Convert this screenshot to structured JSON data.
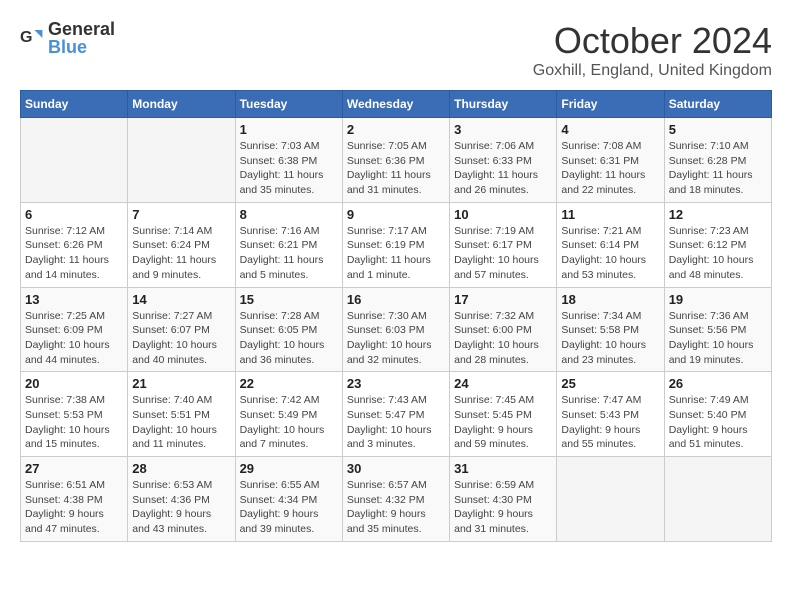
{
  "logo": {
    "general": "General",
    "blue": "Blue"
  },
  "title": "October 2024",
  "location": "Goxhill, England, United Kingdom",
  "days_of_week": [
    "Sunday",
    "Monday",
    "Tuesday",
    "Wednesday",
    "Thursday",
    "Friday",
    "Saturday"
  ],
  "weeks": [
    [
      {
        "day": "",
        "info": ""
      },
      {
        "day": "",
        "info": ""
      },
      {
        "day": "1",
        "info": "Sunrise: 7:03 AM\nSunset: 6:38 PM\nDaylight: 11 hours and 35 minutes."
      },
      {
        "day": "2",
        "info": "Sunrise: 7:05 AM\nSunset: 6:36 PM\nDaylight: 11 hours and 31 minutes."
      },
      {
        "day": "3",
        "info": "Sunrise: 7:06 AM\nSunset: 6:33 PM\nDaylight: 11 hours and 26 minutes."
      },
      {
        "day": "4",
        "info": "Sunrise: 7:08 AM\nSunset: 6:31 PM\nDaylight: 11 hours and 22 minutes."
      },
      {
        "day": "5",
        "info": "Sunrise: 7:10 AM\nSunset: 6:28 PM\nDaylight: 11 hours and 18 minutes."
      }
    ],
    [
      {
        "day": "6",
        "info": "Sunrise: 7:12 AM\nSunset: 6:26 PM\nDaylight: 11 hours and 14 minutes."
      },
      {
        "day": "7",
        "info": "Sunrise: 7:14 AM\nSunset: 6:24 PM\nDaylight: 11 hours and 9 minutes."
      },
      {
        "day": "8",
        "info": "Sunrise: 7:16 AM\nSunset: 6:21 PM\nDaylight: 11 hours and 5 minutes."
      },
      {
        "day": "9",
        "info": "Sunrise: 7:17 AM\nSunset: 6:19 PM\nDaylight: 11 hours and 1 minute."
      },
      {
        "day": "10",
        "info": "Sunrise: 7:19 AM\nSunset: 6:17 PM\nDaylight: 10 hours and 57 minutes."
      },
      {
        "day": "11",
        "info": "Sunrise: 7:21 AM\nSunset: 6:14 PM\nDaylight: 10 hours and 53 minutes."
      },
      {
        "day": "12",
        "info": "Sunrise: 7:23 AM\nSunset: 6:12 PM\nDaylight: 10 hours and 48 minutes."
      }
    ],
    [
      {
        "day": "13",
        "info": "Sunrise: 7:25 AM\nSunset: 6:09 PM\nDaylight: 10 hours and 44 minutes."
      },
      {
        "day": "14",
        "info": "Sunrise: 7:27 AM\nSunset: 6:07 PM\nDaylight: 10 hours and 40 minutes."
      },
      {
        "day": "15",
        "info": "Sunrise: 7:28 AM\nSunset: 6:05 PM\nDaylight: 10 hours and 36 minutes."
      },
      {
        "day": "16",
        "info": "Sunrise: 7:30 AM\nSunset: 6:03 PM\nDaylight: 10 hours and 32 minutes."
      },
      {
        "day": "17",
        "info": "Sunrise: 7:32 AM\nSunset: 6:00 PM\nDaylight: 10 hours and 28 minutes."
      },
      {
        "day": "18",
        "info": "Sunrise: 7:34 AM\nSunset: 5:58 PM\nDaylight: 10 hours and 23 minutes."
      },
      {
        "day": "19",
        "info": "Sunrise: 7:36 AM\nSunset: 5:56 PM\nDaylight: 10 hours and 19 minutes."
      }
    ],
    [
      {
        "day": "20",
        "info": "Sunrise: 7:38 AM\nSunset: 5:53 PM\nDaylight: 10 hours and 15 minutes."
      },
      {
        "day": "21",
        "info": "Sunrise: 7:40 AM\nSunset: 5:51 PM\nDaylight: 10 hours and 11 minutes."
      },
      {
        "day": "22",
        "info": "Sunrise: 7:42 AM\nSunset: 5:49 PM\nDaylight: 10 hours and 7 minutes."
      },
      {
        "day": "23",
        "info": "Sunrise: 7:43 AM\nSunset: 5:47 PM\nDaylight: 10 hours and 3 minutes."
      },
      {
        "day": "24",
        "info": "Sunrise: 7:45 AM\nSunset: 5:45 PM\nDaylight: 9 hours and 59 minutes."
      },
      {
        "day": "25",
        "info": "Sunrise: 7:47 AM\nSunset: 5:43 PM\nDaylight: 9 hours and 55 minutes."
      },
      {
        "day": "26",
        "info": "Sunrise: 7:49 AM\nSunset: 5:40 PM\nDaylight: 9 hours and 51 minutes."
      }
    ],
    [
      {
        "day": "27",
        "info": "Sunrise: 6:51 AM\nSunset: 4:38 PM\nDaylight: 9 hours and 47 minutes."
      },
      {
        "day": "28",
        "info": "Sunrise: 6:53 AM\nSunset: 4:36 PM\nDaylight: 9 hours and 43 minutes."
      },
      {
        "day": "29",
        "info": "Sunrise: 6:55 AM\nSunset: 4:34 PM\nDaylight: 9 hours and 39 minutes."
      },
      {
        "day": "30",
        "info": "Sunrise: 6:57 AM\nSunset: 4:32 PM\nDaylight: 9 hours and 35 minutes."
      },
      {
        "day": "31",
        "info": "Sunrise: 6:59 AM\nSunset: 4:30 PM\nDaylight: 9 hours and 31 minutes."
      },
      {
        "day": "",
        "info": ""
      },
      {
        "day": "",
        "info": ""
      }
    ]
  ]
}
